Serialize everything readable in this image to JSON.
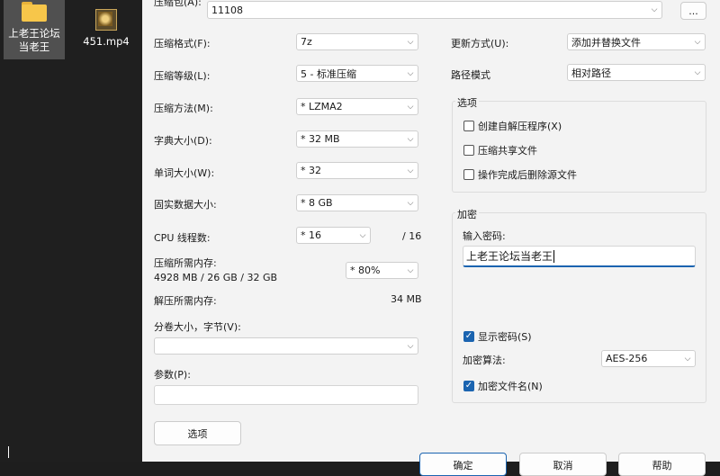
{
  "desktop": {
    "folder_label": "上老王论坛当老王",
    "file_label": "451.mp4"
  },
  "archive": {
    "label": "压缩包(A):",
    "value": "11108",
    "browse": "..."
  },
  "left": {
    "format_label": "压缩格式(F):",
    "format_value": "7z",
    "level_label": "压缩等级(L):",
    "level_value": "5 - 标准压缩",
    "method_label": "压缩方法(M):",
    "method_value": "* LZMA2",
    "dict_label": "字典大小(D):",
    "dict_value": "* 32 MB",
    "word_label": "单词大小(W):",
    "word_value": "* 32",
    "solid_label": "固实数据大小:",
    "solid_value": "* 8 GB",
    "cpu_label": "CPU 线程数:",
    "cpu_value": "* 16",
    "cpu_total": "/ 16",
    "mem_label": "压缩所需内存:",
    "mem_value": "4928 MB / 26 GB / 32 GB",
    "mem_percent": "* 80%",
    "decomp_label": "解压所需内存:",
    "decomp_value": "34 MB",
    "split_label": "分卷大小，字节(V):",
    "split_value": "",
    "params_label": "参数(P):",
    "params_value": "",
    "options_button": "选项"
  },
  "right": {
    "update_label": "更新方式(U):",
    "update_value": "添加并替换文件",
    "path_label": "路径模式",
    "path_value": "相对路径",
    "options_group": "选项",
    "opt_sfx": "创建自解压程序(X)",
    "opt_sfx_checked": false,
    "opt_shared": "压缩共享文件",
    "opt_shared_checked": false,
    "opt_delete": "操作完成后删除源文件",
    "opt_delete_checked": false,
    "encrypt_group": "加密",
    "password_label": "输入密码:",
    "password_value": "上老王论坛当老王",
    "show_password": "显示密码(S)",
    "show_password_checked": true,
    "algo_label": "加密算法:",
    "algo_value": "AES-256",
    "encrypt_names": "加密文件名(N)",
    "encrypt_names_checked": true
  },
  "footer": {
    "ok": "确定",
    "cancel": "取消",
    "help": "帮助"
  },
  "colors": {
    "accent": "#1b64b0",
    "dialog_bg": "#f3f3f3",
    "desktop_bg": "#1f1f1f"
  }
}
